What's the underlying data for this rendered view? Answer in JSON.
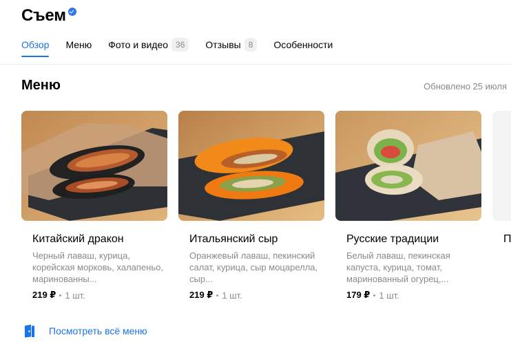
{
  "header": {
    "org_name": "Съем"
  },
  "tabs": [
    {
      "label": "Обзор",
      "count": ""
    },
    {
      "label": "Меню",
      "count": ""
    },
    {
      "label": "Фото и видео",
      "count": "36"
    },
    {
      "label": "Отзывы",
      "count": "8"
    },
    {
      "label": "Особенности",
      "count": ""
    }
  ],
  "menu": {
    "title": "Меню",
    "updated": "Обновлено 25 июля",
    "items": [
      {
        "name": "Китайский дракон",
        "description": "Черный лаваш, курица, корейская морковь, халапеньо, маринованны...",
        "price": "219 ₽",
        "unit": "1 шт."
      },
      {
        "name": "Итальянский сыр",
        "description": "Оранжевый лаваш, пекинский салат, курица, сыр моцарелла, сыр...",
        "price": "219 ₽",
        "unit": "1 шт."
      },
      {
        "name": "Русские традиции",
        "description": "Белый лаваш, пекинская капуста, курица, томат, маринованный огурец,...",
        "price": "179 ₽",
        "unit": "1 шт."
      },
      {
        "name": "П"
      }
    ],
    "see_all": "Посмотреть всё меню"
  },
  "colors": {
    "accent": "#1a73e8",
    "verified": "#3077e8"
  }
}
